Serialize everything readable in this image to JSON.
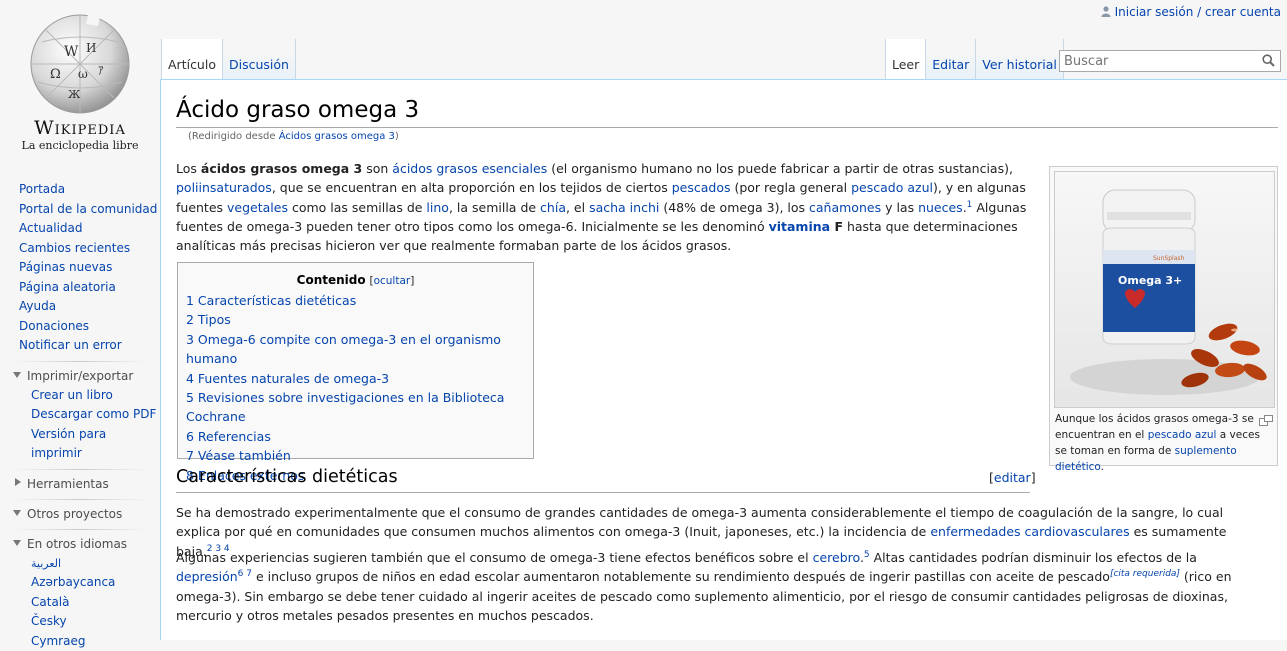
{
  "personal": {
    "login": "Iniciar sesión / crear cuenta"
  },
  "logo": {
    "wordmark": "Wikipedia",
    "tagline": "La enciclopedia libre"
  },
  "navigation": [
    "Portada",
    "Portal de la comunidad",
    "Actualidad",
    "Cambios recientes",
    "Páginas nuevas",
    "Página aleatoria",
    "Ayuda",
    "Donaciones",
    "Notificar un error"
  ],
  "print": {
    "heading": "Imprimir/exportar",
    "items": [
      "Crear un libro",
      "Descargar como PDF",
      "Versión para imprimir"
    ]
  },
  "tools": {
    "heading": "Herramientas"
  },
  "projects": {
    "heading": "Otros proyectos"
  },
  "languages": {
    "heading": "En otros idiomas",
    "items": [
      "العربية",
      "Azərbaycanca",
      "Català",
      "Česky",
      "Cymraeg"
    ]
  },
  "tabs": {
    "article": "Artículo",
    "discussion": "Discusión",
    "read": "Leer",
    "edit": "Editar",
    "history": "Ver historial"
  },
  "search": {
    "placeholder": "Buscar"
  },
  "article": {
    "title": "Ácido graso omega 3",
    "redirect_prefix": "(Redirigido desde ",
    "redirect_link": "Ácidos grasos omega 3",
    "redirect_suffix": ")",
    "intro": {
      "t1": "Los ",
      "b1": "ácidos grasos omega 3",
      "t2": " son ",
      "l1": "ácidos grasos esenciales",
      "t3": " (el organismo humano no los puede fabricar a partir de otras sustancias), ",
      "l2": "poliinsaturados",
      "t4": ", que se encuentran en alta proporción en los tejidos de ciertos ",
      "l3": "pescados",
      "t5": " (por regla general ",
      "l4": "pescado azul",
      "t6": "), y en algunas fuentes ",
      "l5": "vegetales",
      "t7": " como las semillas de ",
      "l6": "lino",
      "t8": ", la semilla de ",
      "l7": "chía",
      "t9": ", el ",
      "l8": "sacha inchi",
      "t10": " (48% de omega 3), los ",
      "l9": "cañamones",
      "t11": " y las ",
      "l10": "nueces",
      "t12": ".",
      "s1": "1",
      "t13": " Algunas fuentes de omega-3 pueden tener otro tipos como los omega-6. Inicialmente se les denominó ",
      "l11": "vitamina",
      "b2": " F",
      "t14": " hasta que determinaciones analíticas más precisas hicieron ver que realmente formaban parte de los ácidos grasos."
    },
    "toc": {
      "title": "Contenido",
      "toggle_open": "[",
      "toggle": "ocultar",
      "toggle_close": "]",
      "items": [
        "1 Características dietéticas",
        "2 Tipos",
        "3 Omega-6 compite con omega-3 en el organismo humano",
        "4 Fuentes naturales de omega-3",
        "5 Revisiones sobre investigaciones en la Biblioteca Cochrane",
        "6 Referencias",
        "7 Véase también",
        "8 Enlaces externos"
      ]
    },
    "thumb": {
      "bottle_label": "Omega 3+",
      "caption_t1": "Aunque los ácidos grasos omega-3 se encuentran en el ",
      "caption_l1": "pescado azul",
      "caption_t2": " a veces se toman en forma de ",
      "caption_l2": "suplemento dietético",
      "caption_t3": "."
    },
    "section1": {
      "title": "Características dietéticas",
      "edit_open": "[",
      "edit": "editar",
      "edit_close": "]",
      "p1_t1": "Se ha demostrado experimentalmente que el consumo de grandes cantidades de omega-3 aumenta considerablemente el tiempo de coagulación de la sangre, lo cual explica por qué en comunidades que consumen muchos alimentos con omega-3 (Inuit, japoneses, etc.) la incidencia de ",
      "p1_l1": "enfermedades cardiovasculares",
      "p1_t2": " es sumamente baja.",
      "p1_s1": "2",
      "p1_s2": "3",
      "p1_s3": "4",
      "p2_t1": "Algunas experiencias sugieren también que el consumo de omega-3 tiene efectos benéficos sobre el ",
      "p2_l1": "cerebro",
      "p2_t2": ".",
      "p2_s1": "5",
      "p2_t3": " Altas cantidades podrían disminuir los efectos de la ",
      "p2_l2": "depresión",
      "p2_s2": "6",
      "p2_s3": "7",
      "p2_t4": " e incluso grupos de niños en edad escolar aumentaron notablemente su rendimiento después de ingerir pastillas con aceite de pescado",
      "p2_cite": "[cita requerida]",
      "p2_t5": " (rico en omega-3). Sin embargo se debe tener cuidado al ingerir aceites de pescado como suplemento alimenticio, por el riesgo de consumir cantidades peligrosas de dioxinas, mercurio y otros metales pesados presentes en muchos pescados."
    }
  }
}
